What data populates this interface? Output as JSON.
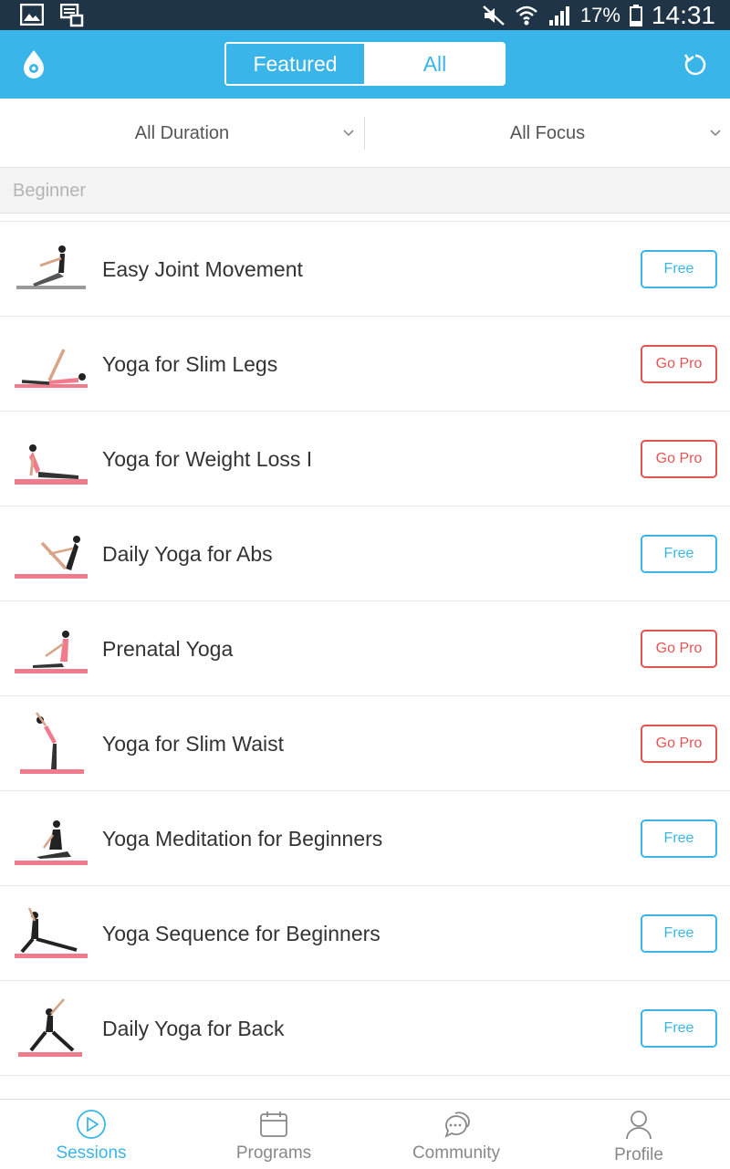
{
  "status_bar": {
    "battery": "17%",
    "time": "14:31"
  },
  "header": {
    "tabs": [
      {
        "label": "Featured"
      },
      {
        "label": "All"
      }
    ]
  },
  "filters": {
    "duration": "All Duration",
    "focus": "All Focus"
  },
  "section": {
    "title": "Beginner"
  },
  "sessions": [
    {
      "title": "Easy Joint Movement",
      "badge": "Free",
      "type": "free"
    },
    {
      "title": "Yoga for Slim Legs",
      "badge": "Go Pro",
      "type": "pro"
    },
    {
      "title": "Yoga for Weight Loss I",
      "badge": "Go Pro",
      "type": "pro"
    },
    {
      "title": "Daily Yoga for Abs",
      "badge": "Free",
      "type": "free"
    },
    {
      "title": "Prenatal Yoga",
      "badge": "Go Pro",
      "type": "pro"
    },
    {
      "title": "Yoga for Slim Waist",
      "badge": "Go Pro",
      "type": "pro"
    },
    {
      "title": "Yoga Meditation for Beginners",
      "badge": "Free",
      "type": "free"
    },
    {
      "title": "Yoga Sequence for Beginners",
      "badge": "Free",
      "type": "free"
    },
    {
      "title": "Daily Yoga for Back",
      "badge": "Free",
      "type": "free"
    }
  ],
  "bottom_nav": [
    {
      "label": "Sessions",
      "icon": "play-circle-icon",
      "active": true
    },
    {
      "label": "Programs",
      "icon": "calendar-icon",
      "active": false
    },
    {
      "label": "Community",
      "icon": "chat-bubbles-icon",
      "active": false
    },
    {
      "label": "Profile",
      "icon": "person-icon",
      "active": false
    }
  ],
  "colors": {
    "accent": "#3ab5ea",
    "pro": "#e35553",
    "status_bar": "#1f3447"
  }
}
